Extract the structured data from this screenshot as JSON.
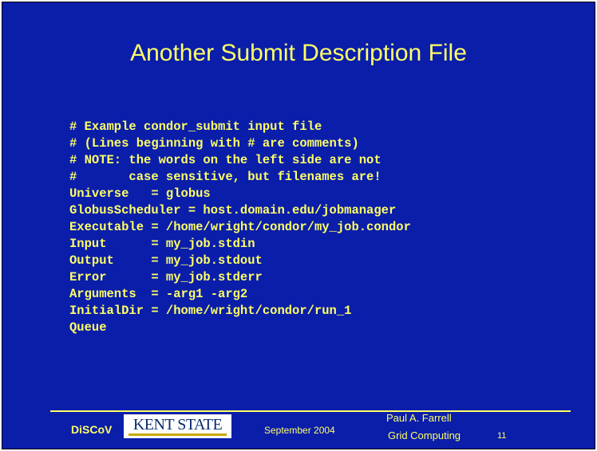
{
  "slide": {
    "title": "Another Submit Description File",
    "code_lines": [
      "# Example condor_submit input file",
      "# (Lines beginning with # are comments)",
      "# NOTE: the words on the left side are not",
      "#       case sensitive, but filenames are!",
      "Universe   = globus",
      "GlobusScheduler = host.domain.edu/jobmanager",
      "Executable = /home/wright/condor/my_job.condor",
      "Input      = my_job.stdin",
      "Output     = my_job.stdout",
      "Error      = my_job.stderr",
      "Arguments  = -arg1 -arg2",
      "InitialDir = /home/wright/condor/run_1",
      "Queue"
    ]
  },
  "footer": {
    "org": "DiSCoV",
    "logo_text": "KENT STATE",
    "date": "September 2004",
    "author": "Paul A. Farrell",
    "course": "Grid Computing",
    "page_number": "11"
  },
  "colors": {
    "background": "#0a1eaa",
    "text": "#ffff66"
  }
}
